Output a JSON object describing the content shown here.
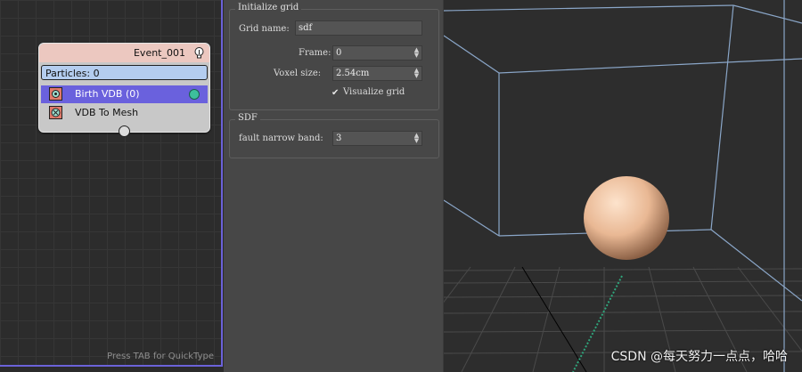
{
  "graph": {
    "event_title": "Event_001",
    "particles_label": "Particles: 0",
    "operators": [
      {
        "label": "Birth VDB (0)"
      },
      {
        "label": "VDB To Mesh"
      }
    ],
    "quicktype_hint": "Press TAB for QuickType"
  },
  "params": {
    "init_group": {
      "title": "Initialize grid",
      "grid_name_label": "Grid name:",
      "grid_name_value": "sdf",
      "frame_label": "Frame:",
      "frame_value": "0",
      "voxel_label": "Voxel size:",
      "voxel_value": "2.54cm",
      "visualize_label": "Visualize grid",
      "visualize_checked": "✔"
    },
    "sdf_group": {
      "title": "SDF",
      "band_label": "fault narrow band:",
      "band_value": "3"
    }
  },
  "viewport": {
    "watermark": "CSDN @每天努力一点点，哈哈",
    "colors": {
      "box_edges": "#8aa6c8",
      "sphere": "#e9b894",
      "background": "#2d2d2d"
    }
  }
}
